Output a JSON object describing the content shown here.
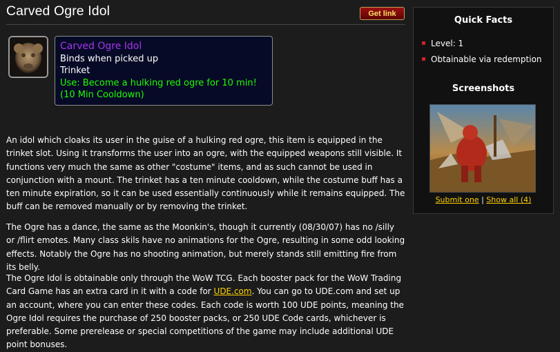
{
  "page": {
    "title": "Carved Ogre Idol",
    "get_link": "Get link"
  },
  "item": {
    "icon": "ogre-idol-icon",
    "name": "Carved Ogre Idol",
    "bind": "Binds when picked up",
    "slot": "Trinket",
    "use": "Use: Become a hulking red ogre for 10 min! (10 Min Cooldown)",
    "colors": {
      "name": "#a335ee",
      "use": "#1eff00",
      "tooltip_bg": "#070a26"
    }
  },
  "description": {
    "p1": "An idol which cloaks its user in the guise of a hulking red ogre, this item is equipped in the trinket slot. Using it transforms the user into an ogre, with the equipped weapons still visible. It functions very much the same as other \"costume\" items, and as such cannot be used in conjunction with a mount. The trinket has a ten minute cooldown, while the costume buff has a ten minute expiration, so it can be used essentially continuously while it remains equipped. The buff can be removed manually or by removing the trinket.",
    "p2": "The Ogre has a dance, the same as the Moonkin's, though it currently (08/30/07) has no /silly or /flirt emotes. Many class skils have no animations for the Ogre, resulting in some odd looking effects. Notably the Ogre has no shooting animation, but merely stands still emitting fire from its belly.",
    "p3_before": "The Ogre Idol is obtainable only through the WoW TCG. Each booster pack for the WoW Trading Card Game has an extra card in it with a code for ",
    "p3_link": "UDE.com",
    "p3_after": ". You can go to UDE.com and set up an account, where you can enter these codes. Each code is worth 100 UDE points, meaning the Ogre Idol requires the purchase of 250 booster packs, or 250 UDE Code cards, whichever is preferable. Some prerelease or special competitions of the game may include additional UDE point bonuses."
  },
  "sidebar": {
    "quick_facts_title": "Quick Facts",
    "facts": [
      "Level: 1",
      "Obtainable via redemption"
    ],
    "screenshots_title": "Screenshots",
    "submit_label": "Submit one",
    "separator": "|",
    "show_all_label": "Show all (4)"
  }
}
